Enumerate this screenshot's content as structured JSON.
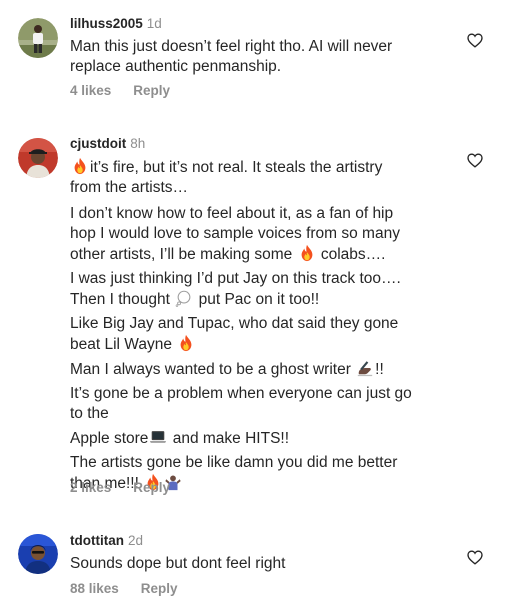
{
  "comments": [
    {
      "username": "lilhuss2005",
      "time": "1d",
      "paragraphs": [
        [
          "Man this just doesn’t feel right tho. AI will never",
          "replace authentic penmanship."
        ]
      ],
      "likes": "4 likes",
      "reply": "Reply"
    },
    {
      "username": "cjustdoit",
      "time": "8h",
      "text": {
        "p1_l1": "it’s fire, but it’s not real. It steals the artistry",
        "p1_l2": "from the artists…",
        "p2_l1": "I don’t know how to feel about it, as a fan of hip",
        "p2_l2": "hop I would love to sample voices from so many",
        "p2_l3a": "other artists, I’ll be making some ",
        "p2_l3b": " colabs….",
        "p3_l1": "I was just thinking I’d put Jay on this track too….",
        "p3_l2a": "Then I thought ",
        "p3_l2b": " put Pac on it too!!",
        "p4_l1": "Like Big Jay and Tupac, who dat said they gone",
        "p4_l2a": "beat Lil Wayne ",
        "p5_l1a": "Man I always wanted to be a ghost writer ",
        "p5_l1b": "!!",
        "p6_l1": "It’s gone be a problem when everyone can just go",
        "p6_l2": "to the",
        "p7_l1a": "Apple store",
        "p7_l1b": " and make HITS!!",
        "p8_l1": "The artists gone be like damn you did me better",
        "p8_l2a": "than me!!! "
      },
      "emoji": {
        "fire": "fire-emoji",
        "thought": "thought-bubble-emoji",
        "writing": "writing-hand-emoji",
        "laptop": "laptop-emoji",
        "shrug": "person-shrugging-emoji"
      },
      "likes": "2 likes",
      "reply": "Reply"
    },
    {
      "username": "tdottitan",
      "time": "2d",
      "paragraphs": [
        [
          "Sounds dope but dont feel right"
        ]
      ],
      "likes": "88 likes",
      "reply": "Reply"
    }
  ],
  "icons": {
    "like": "heart-outline-icon"
  },
  "colors": {
    "text": "#262626",
    "secondary": "#8e8e8e",
    "background": "#ffffff"
  }
}
